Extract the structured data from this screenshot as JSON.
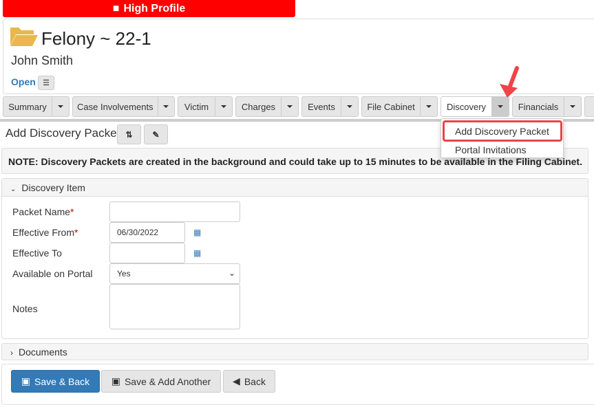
{
  "banner": {
    "label": "High Profile",
    "icon": "folder-badge-icon"
  },
  "case": {
    "title": "Felony ~ 22-1",
    "person": "John Smith",
    "status": "Open"
  },
  "tabs": [
    {
      "label": "Summary"
    },
    {
      "label": "Case Involvements"
    },
    {
      "label": "Victim"
    },
    {
      "label": "Charges"
    },
    {
      "label": "Events"
    },
    {
      "label": "File Cabinet"
    },
    {
      "label": "Discovery"
    },
    {
      "label": "Financials"
    },
    {
      "label": ""
    }
  ],
  "menu": {
    "items": [
      "Add Discovery Packet",
      "Portal Invitations"
    ]
  },
  "page": {
    "title": "Add Discovery Packet"
  },
  "note": "NOTE: Discovery Packets are created in the background and could take up to 15 minutes to be available in the Filing Cabinet.",
  "panel": {
    "title": "Discovery Item",
    "fields": {
      "packet_name": {
        "label": "Packet Name",
        "value": ""
      },
      "effective_from": {
        "label": "Effective From",
        "value": "06/30/2022"
      },
      "effective_to": {
        "label": "Effective To",
        "value": ""
      },
      "portal": {
        "label": "Available on Portal",
        "value": "Yes"
      },
      "notes": {
        "label": "Notes",
        "value": ""
      }
    },
    "required": "*"
  },
  "documents": {
    "title": "Documents"
  },
  "buttons": {
    "save_back": "Save & Back",
    "save_add": "Save & Add Another",
    "back": "Back"
  },
  "colors": {
    "banner": "#ff0000",
    "primary": "#337ab7",
    "highlight": "#e8434a"
  }
}
